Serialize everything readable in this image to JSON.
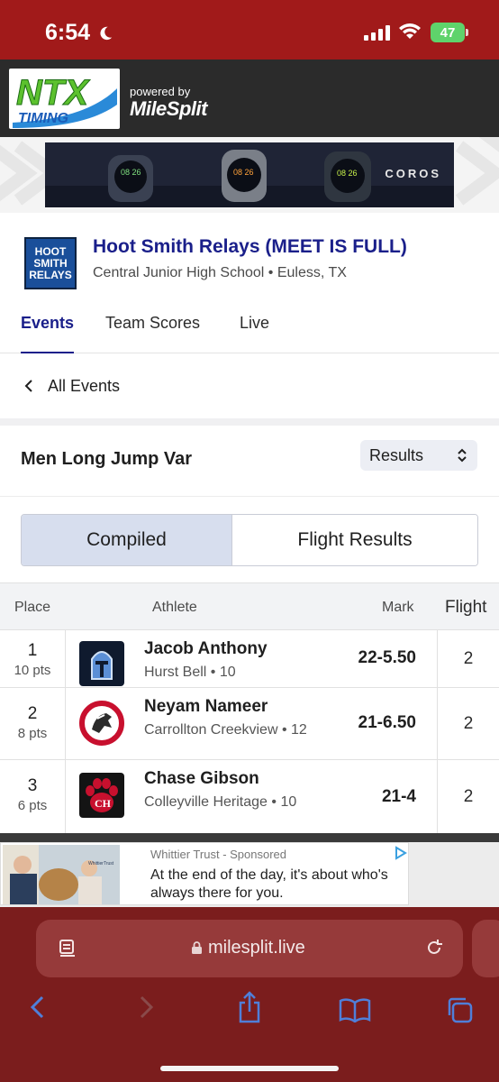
{
  "status": {
    "time": "6:54",
    "battery": "47"
  },
  "brand": {
    "ntx_logo_text": [
      "NTX",
      "TIMING"
    ],
    "powered_by": "powered by",
    "milesplit": "MileSplit"
  },
  "banner_ad": {
    "brand": "COROS",
    "watch_readouts": [
      "08 26",
      "08 26",
      "08 26"
    ]
  },
  "meet": {
    "logo_text": [
      "HOOT",
      "SMITH",
      "RELAYS"
    ],
    "title": "Hoot Smith Relays (MEET IS FULL)",
    "subtitle": "Central Junior High School • Euless, TX"
  },
  "tabs": [
    {
      "label": "Events",
      "active": true
    },
    {
      "label": "Team Scores",
      "active": false
    },
    {
      "label": "Live",
      "active": false
    }
  ],
  "back_link": "All Events",
  "event": {
    "title": "Men Long Jump Var",
    "view_select": "Results"
  },
  "segments": [
    {
      "label": "Compiled",
      "active": true
    },
    {
      "label": "Flight Results",
      "active": false
    }
  ],
  "table": {
    "headers": {
      "place": "Place",
      "athlete": "Athlete",
      "mark": "Mark",
      "flight": "Flight"
    },
    "rows": [
      {
        "place": "1",
        "points": "10 pts",
        "athlete": "Jacob Anthony",
        "school": "Hurst Bell • 10",
        "mark": "22-5.50",
        "flight": "2",
        "logo": "knight-helmet-icon",
        "logo_color": "#1c3c74"
      },
      {
        "place": "2",
        "points": "8 pts",
        "athlete": "Neyam Nameer",
        "school": "Carrollton Creekview • 12",
        "mark": "21-6.50",
        "flight": "2",
        "logo": "mustang-icon",
        "logo_color": "#c8102e"
      },
      {
        "place": "3",
        "points": "6 pts",
        "athlete": "Chase Gibson",
        "school": "Colleyville Heritage • 10",
        "mark": "21-4",
        "flight": "2",
        "logo": "paw-ch-icon",
        "logo_color": "#c8102e"
      }
    ]
  },
  "bottom_ad": {
    "sponsor": "Whittier Trust",
    "sponsored_label": "Sponsored",
    "text": "At the end of the day, it's about who's always there for you.",
    "photo_caption": "WhittierTrust"
  },
  "browser": {
    "domain": "milesplit.live"
  },
  "colors": {
    "accent": "#1a1f8a",
    "status_bar": "#a11a1a",
    "safari_bar": "#7b1d1d",
    "icon_blue": "#4f7fd9"
  }
}
